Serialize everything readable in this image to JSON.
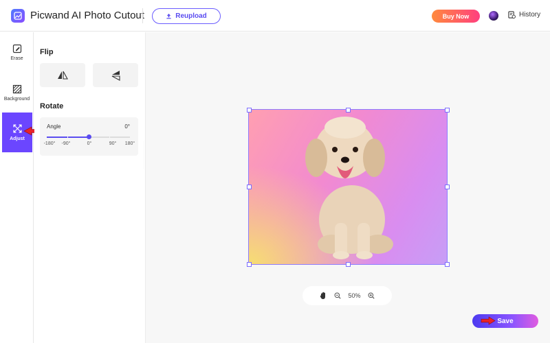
{
  "header": {
    "app_title": "Picwand AI Photo Cutout",
    "reupload_label": "Reupload",
    "buy_now_label": "Buy Now",
    "history_label": "History"
  },
  "rail": {
    "items": [
      {
        "label": "Erase",
        "icon": "eraser-icon"
      },
      {
        "label": "Background",
        "icon": "background-pattern-icon"
      },
      {
        "label": "Adjust",
        "icon": "expand-arrows-icon",
        "active": true
      }
    ]
  },
  "panel": {
    "flip_title": "Flip",
    "flip_buttons": [
      {
        "icon": "flip-horizontal-icon"
      },
      {
        "icon": "flip-vertical-icon"
      }
    ],
    "rotate_title": "Rotate",
    "angle_label": "Angle",
    "angle_value": "0°",
    "slider": {
      "min": -180,
      "max": 180,
      "value": 0
    },
    "ticks": [
      "-180°",
      "-90°",
      "0°",
      "90°",
      "180°"
    ]
  },
  "canvas": {
    "background_colors": [
      "#f6de72",
      "#ff9fb1",
      "#f28ad0",
      "#c79ef6"
    ],
    "subject": "puppy-cutout-image"
  },
  "zoom": {
    "level": "50%"
  },
  "actions": {
    "save_label": "Save"
  },
  "colors": {
    "accent": "#6b46ff",
    "buy_now_gradient": [
      "#ff8a3d",
      "#ff3f7f"
    ],
    "annotation_arrow": "#e8232a"
  }
}
